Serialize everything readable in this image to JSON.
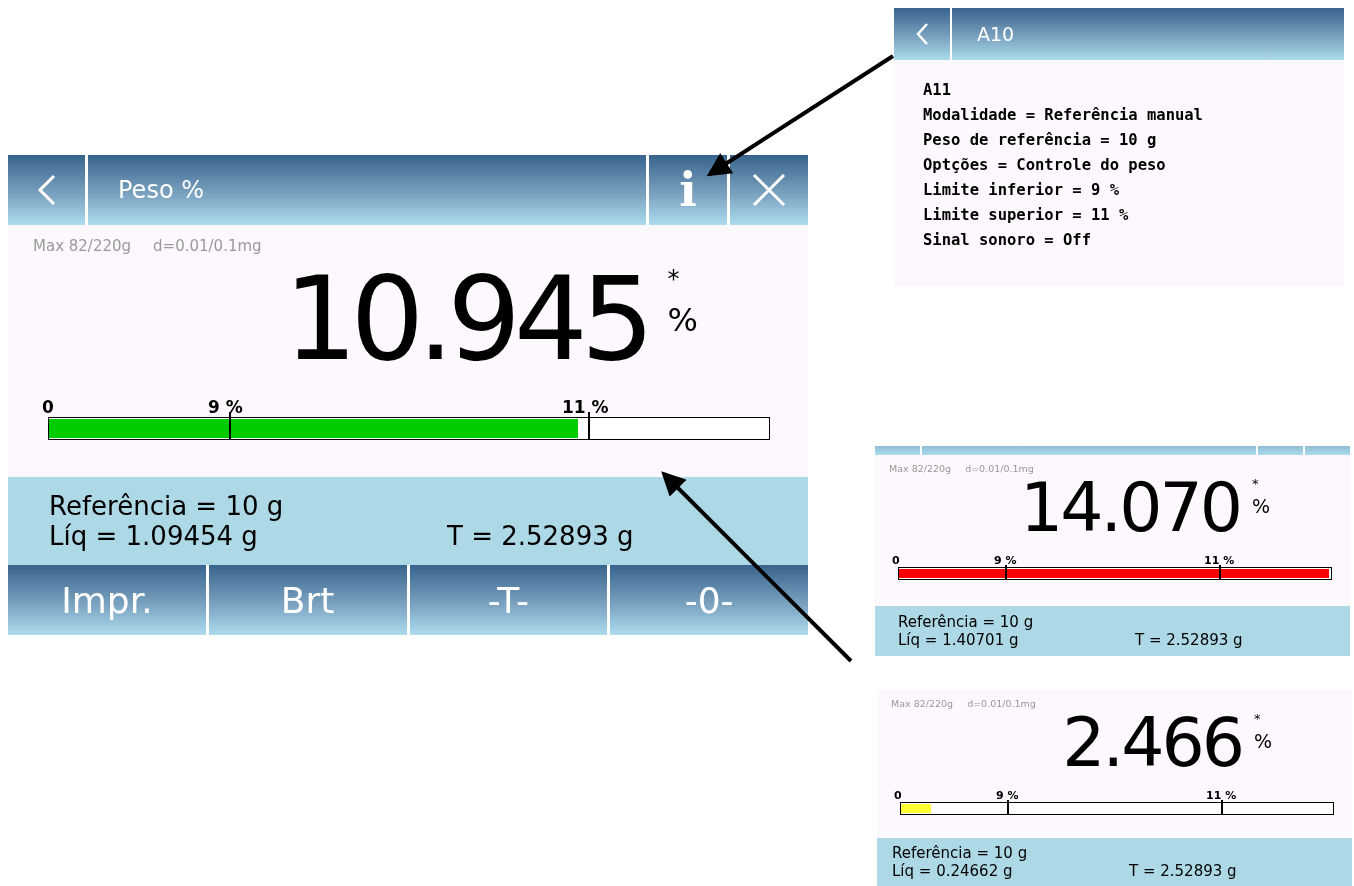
{
  "main_screen": {
    "title": "Peso %",
    "info_button": "i",
    "capacity": "Max 82/220g",
    "division": "d=0.01/0.1mg",
    "reading": "10.945",
    "stability_mark": "*",
    "unit": "%",
    "bar": {
      "zero_label": "0",
      "low_label": "9 %",
      "high_label": "11 %",
      "level": 0.737,
      "color": "#00cc00"
    },
    "reference": "Referência = 10 g",
    "net": "Líq = 1.09454 g",
    "tare": "T = 2.52893 g",
    "buttons": [
      "Impr.",
      "Brt",
      "-T-",
      "-0-"
    ]
  },
  "info_screen": {
    "title": "A10",
    "lines": [
      "A11",
      "Modalidade = Referência manual",
      "Peso de referência = 10 g",
      "Optções = Controle do peso",
      "Limite inferior = 9 %",
      "Limite superior = 11 %",
      "Sinal sonoro = Off"
    ]
  },
  "example_screens": [
    {
      "header_strip": true,
      "capacity": "Max 82/220g",
      "division": "d=0.01/0.1mg",
      "reading": "14.070",
      "stability_mark": "*",
      "unit": "%",
      "bar": {
        "zero_label": "0",
        "low_label": "9 %",
        "high_label": "11 %",
        "level": 1,
        "color": "#ff0000"
      },
      "reference": "Referência = 10 g",
      "net": "Líq = 1.40701 g",
      "tare": "T = 2.52893 g"
    },
    {
      "header_strip": false,
      "capacity": "Max 82/220g",
      "division": "d=0.01/0.1mg",
      "reading": "2.466",
      "stability_mark": "*",
      "unit": "%",
      "bar": {
        "zero_label": "0",
        "low_label": "9 %",
        "high_label": "11 %",
        "level": 0.07,
        "color": "#ffff33"
      },
      "reference": "Referência = 10 g",
      "net": "Líq = 0.24662 g",
      "tare": "T = 2.52893 g"
    }
  ]
}
